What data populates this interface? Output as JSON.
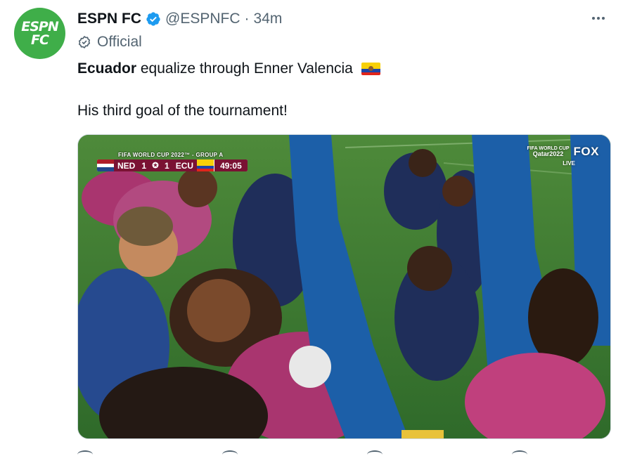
{
  "tweet": {
    "display_name": "ESPN FC",
    "handle": "@ESPNFC",
    "separator": "·",
    "time": "34m",
    "label": "Official",
    "text_bold": "Ecuador",
    "text_rest": " equalize through Enner Valencia",
    "text_line2": "His third goal of the tournament!"
  },
  "avatar": {
    "line1": "ESPN",
    "line2": "FC",
    "color": "#3fae49"
  },
  "scorebug": {
    "competition": "FIFA WORLD CUP 2022™ - GROUP A",
    "home_team": "NED",
    "home_score": "1",
    "away_score": "1",
    "away_team": "ECU",
    "clock": "49:05"
  },
  "broadcast": {
    "event": "FIFA WORLD CUP",
    "event_sub": "Qatar2022",
    "network": "FOX",
    "status": "LIVE"
  },
  "icons": {
    "verified": "verified-badge-icon",
    "official": "official-label-icon",
    "more": "more-options-icon",
    "flag": "ecuador-flag-icon"
  },
  "colors": {
    "text": "#0f1419",
    "secondary": "#536471",
    "verified": "#1d9bf0",
    "scorebug": "#7a1233"
  }
}
